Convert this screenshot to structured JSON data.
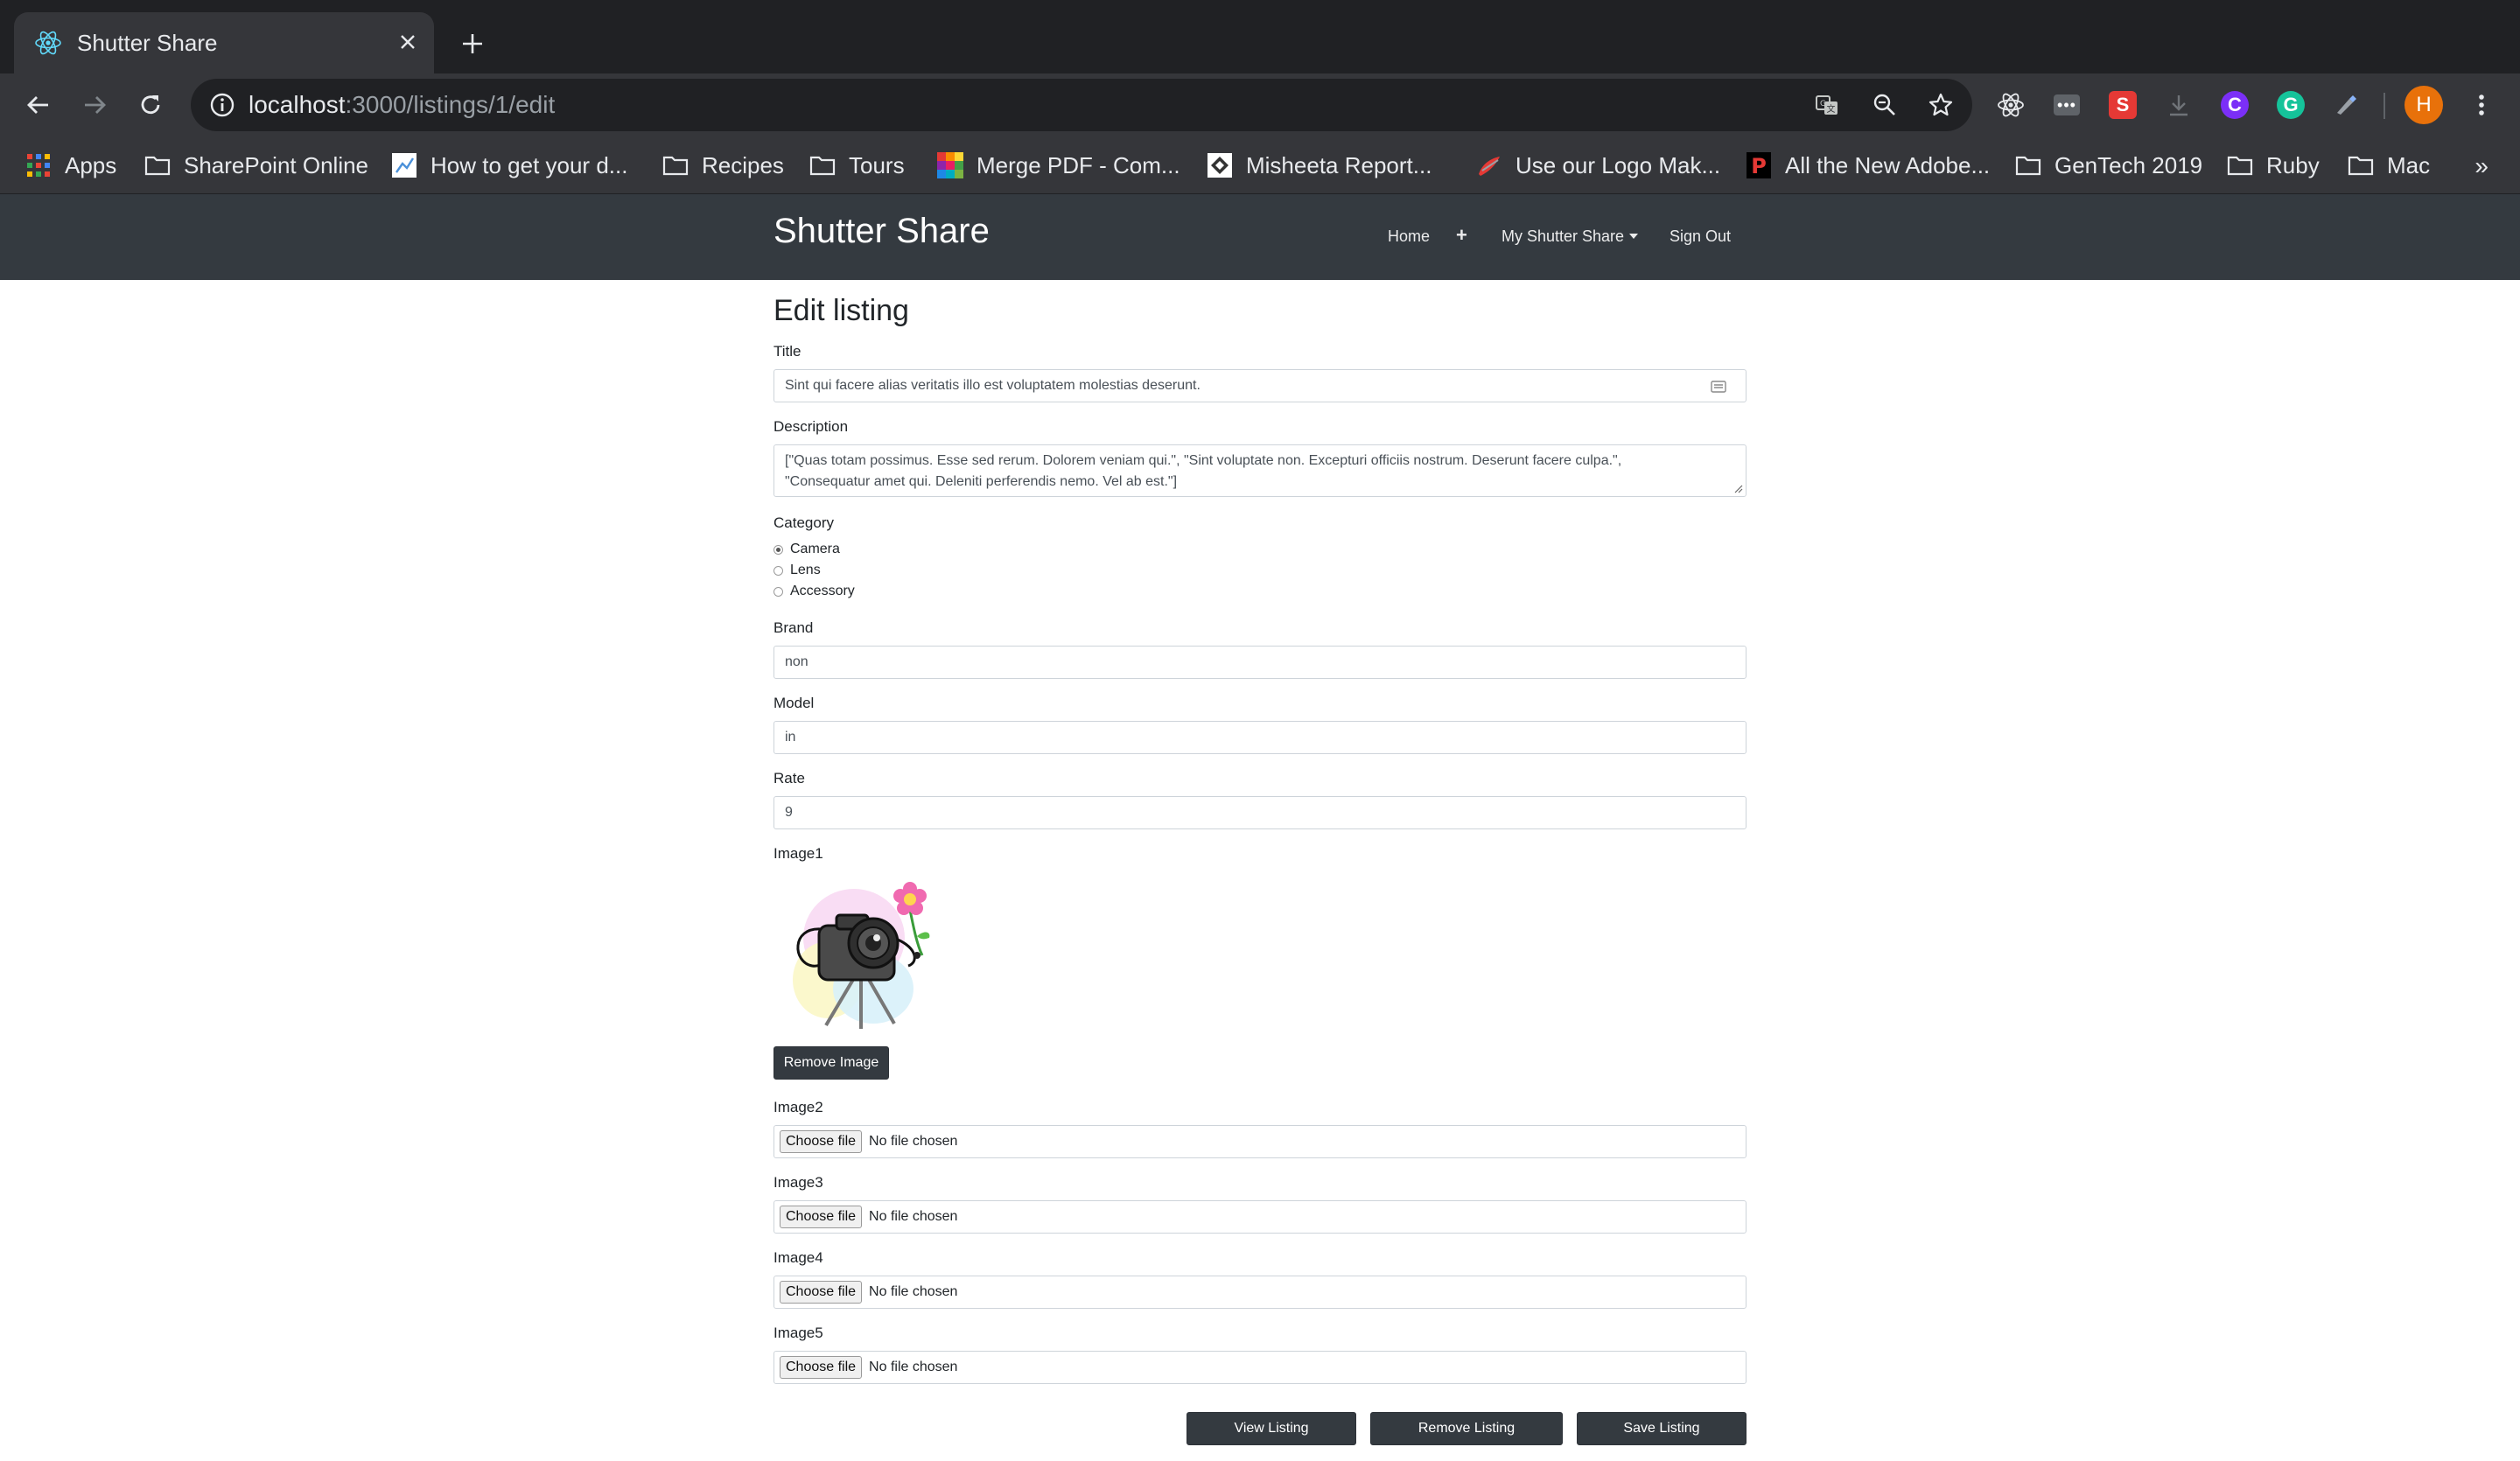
{
  "browser": {
    "tab_title": "Shutter Share",
    "url_host": "localhost",
    "url_path": ":3000/listings/1/edit",
    "profile_initial": "H",
    "extensions": [
      {
        "name": "react-devtools",
        "icon": "react-icon"
      },
      {
        "name": "more-ext",
        "icon": "dots-icon"
      },
      {
        "name": "s-ext",
        "label": "S",
        "color": "#e53935"
      },
      {
        "name": "download-ext",
        "icon": "download-icon"
      },
      {
        "name": "c-ext",
        "label": "C",
        "color": "#7b2ff7"
      },
      {
        "name": "grammarly",
        "label": "G",
        "color": "#15c39a"
      },
      {
        "name": "pen-ext",
        "icon": "pen-icon"
      }
    ],
    "bookmarks": [
      {
        "label": "Apps",
        "icon": "apps-grid-icon"
      },
      {
        "label": "SharePoint Online",
        "icon": "folder-icon"
      },
      {
        "label": "How to get your d...",
        "icon": "page-icon"
      },
      {
        "label": "Recipes",
        "icon": "folder-icon"
      },
      {
        "label": "Tours",
        "icon": "folder-icon"
      },
      {
        "label": "Merge PDF - Com...",
        "icon": "colorful-icon"
      },
      {
        "label": "Misheeta Report...",
        "icon": "report-icon"
      },
      {
        "label": "Use our Logo Mak...",
        "icon": "logo-icon"
      },
      {
        "label": "All the New Adobe...",
        "icon": "p-icon"
      },
      {
        "label": "GenTech 2019",
        "icon": "folder-icon"
      },
      {
        "label": "Ruby",
        "icon": "folder-icon"
      },
      {
        "label": "Mac",
        "icon": "folder-icon"
      }
    ],
    "bookmarks_more": "»"
  },
  "navbar": {
    "brand": "Shutter Share",
    "home": "Home",
    "add": "+",
    "my_shutter_share": "My Shutter Share",
    "sign_out": "Sign Out"
  },
  "form": {
    "heading": "Edit listing",
    "title_label": "Title",
    "title_value": "Sint qui facere alias veritatis illo est voluptatem molestias deserunt.",
    "description_label": "Description",
    "description_line1": "[\"Quas totam possimus. Esse sed rerum. Dolorem veniam qui.\", \"Sint voluptate non. Excepturi officiis nostrum. Deserunt facere culpa.\",",
    "description_line2": "\"Consequatur amet qui. Deleniti perferendis nemo. Vel ab est.\"]",
    "category_label": "Category",
    "categories": [
      {
        "label": "Camera",
        "checked": true
      },
      {
        "label": "Lens",
        "checked": false
      },
      {
        "label": "Accessory",
        "checked": false
      }
    ],
    "brand_label": "Brand",
    "brand_value": "non",
    "model_label": "Model",
    "model_value": "in",
    "rate_label": "Rate",
    "rate_value": "9",
    "image1_label": "Image1",
    "remove_image": "Remove Image",
    "image_fields": [
      {
        "label": "Image2",
        "button": "Choose file",
        "status": "No file chosen"
      },
      {
        "label": "Image3",
        "button": "Choose file",
        "status": "No file chosen"
      },
      {
        "label": "Image4",
        "button": "Choose file",
        "status": "No file chosen"
      },
      {
        "label": "Image5",
        "button": "Choose file",
        "status": "No file chosen"
      }
    ],
    "view_listing": "View Listing",
    "remove_listing": "Remove Listing",
    "save_listing": "Save Listing"
  },
  "colors": {
    "navbar": "#343a40",
    "chrome_dark": "#202124",
    "chrome_mid": "#35363a"
  }
}
